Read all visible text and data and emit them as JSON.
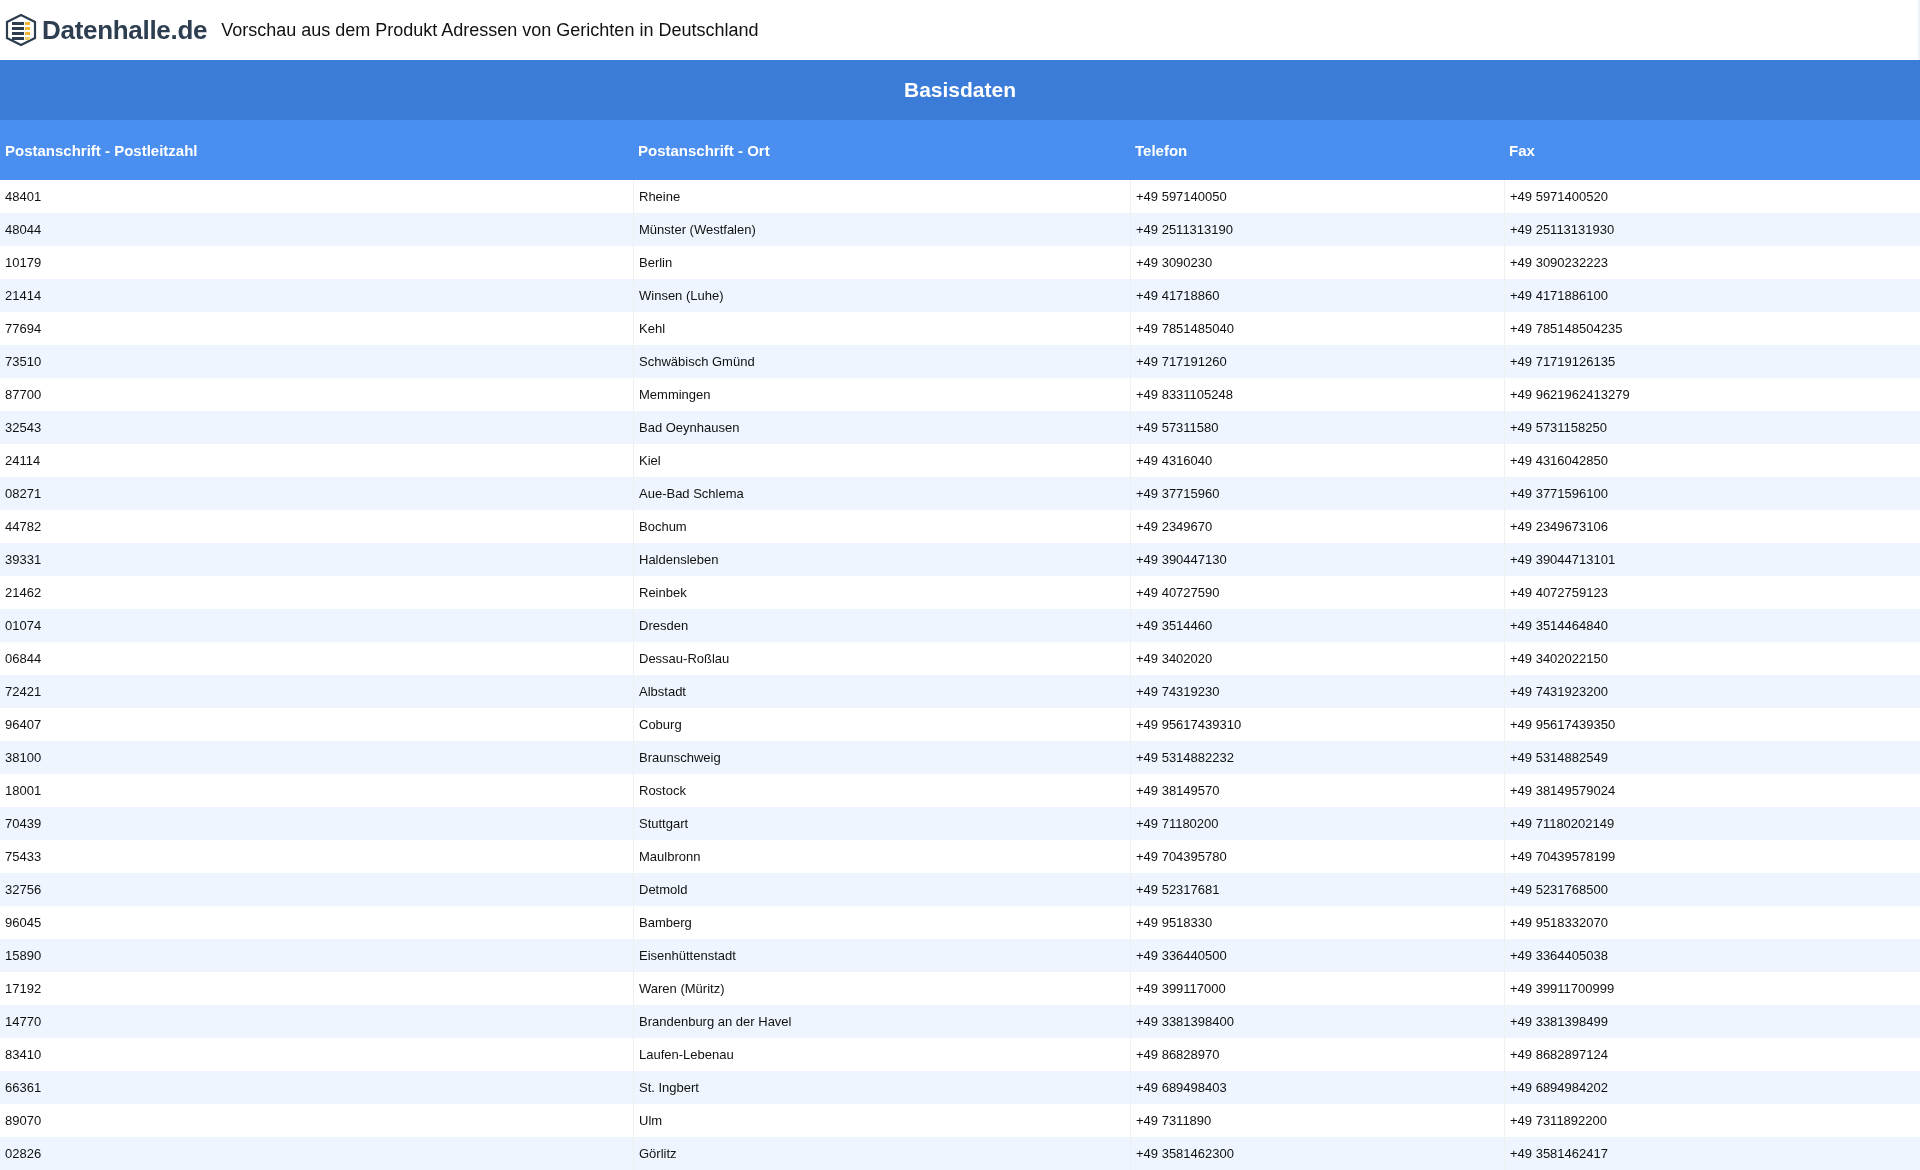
{
  "header": {
    "logo_text": "Datenhalle.de",
    "title": "Vorschau aus dem Produkt Adressen von Gerichten in Deutschland"
  },
  "table": {
    "group_title": "Basisdaten",
    "columns": [
      "Postanschrift - Postleitzahl",
      "Postanschrift - Ort",
      "Telefon",
      "Fax"
    ],
    "rows": [
      [
        "48401",
        "Rheine",
        "+49 597140050",
        "+49 5971400520"
      ],
      [
        "48044",
        "Münster (Westfalen)",
        "+49 2511313190",
        "+49 25113131930"
      ],
      [
        "10179",
        "Berlin",
        "+49 3090230",
        "+49 3090232223"
      ],
      [
        "21414",
        "Winsen (Luhe)",
        "+49 41718860",
        "+49 4171886100"
      ],
      [
        "77694",
        "Kehl",
        "+49 7851485040",
        "+49 785148504235"
      ],
      [
        "73510",
        "Schwäbisch Gmünd",
        "+49 717191260",
        "+49 71719126135"
      ],
      [
        "87700",
        "Memmingen",
        "+49 8331105248",
        "+49 9621962413279"
      ],
      [
        "32543",
        "Bad Oeynhausen",
        "+49 57311580",
        "+49 5731158250"
      ],
      [
        "24114",
        "Kiel",
        "+49 4316040",
        "+49 4316042850"
      ],
      [
        "08271",
        "Aue-Bad Schlema",
        "+49 37715960",
        "+49 3771596100"
      ],
      [
        "44782",
        "Bochum",
        "+49 2349670",
        "+49 2349673106"
      ],
      [
        "39331",
        "Haldensleben",
        "+49 390447130",
        "+49 39044713101"
      ],
      [
        "21462",
        "Reinbek",
        "+49 40727590",
        "+49 4072759123"
      ],
      [
        "01074",
        "Dresden",
        "+49 3514460",
        "+49 3514464840"
      ],
      [
        "06844",
        "Dessau-Roßlau",
        "+49 3402020",
        "+49 3402022150"
      ],
      [
        "72421",
        "Albstadt",
        "+49 74319230",
        "+49 7431923200"
      ],
      [
        "96407",
        "Coburg",
        "+49 95617439310",
        "+49 95617439350"
      ],
      [
        "38100",
        "Braunschweig",
        "+49 5314882232",
        "+49 5314882549"
      ],
      [
        "18001",
        "Rostock",
        "+49 38149570",
        "+49 38149579024"
      ],
      [
        "70439",
        "Stuttgart",
        "+49 71180200",
        "+49 71180202149"
      ],
      [
        "75433",
        "Maulbronn",
        "+49 704395780",
        "+49 70439578199"
      ],
      [
        "32756",
        "Detmold",
        "+49 52317681",
        "+49 5231768500"
      ],
      [
        "96045",
        "Bamberg",
        "+49 9518330",
        "+49 9518332070"
      ],
      [
        "15890",
        "Eisenhüttenstadt",
        "+49 336440500",
        "+49 3364405038"
      ],
      [
        "17192",
        "Waren (Müritz)",
        "+49 399117000",
        "+49 39911700999"
      ],
      [
        "14770",
        "Brandenburg an der Havel",
        "+49 3381398400",
        "+49 3381398499"
      ],
      [
        "83410",
        "Laufen-Lebenau",
        "+49 86828970",
        "+49 8682897124"
      ],
      [
        "66361",
        "St. Ingbert",
        "+49 689498403",
        "+49 6894984202"
      ],
      [
        "89070",
        "Ulm",
        "+49 7311890",
        "+49 7311892200"
      ],
      [
        "02826",
        "Görlitz",
        "+49 3581462300",
        "+49 3581462417"
      ]
    ]
  }
}
